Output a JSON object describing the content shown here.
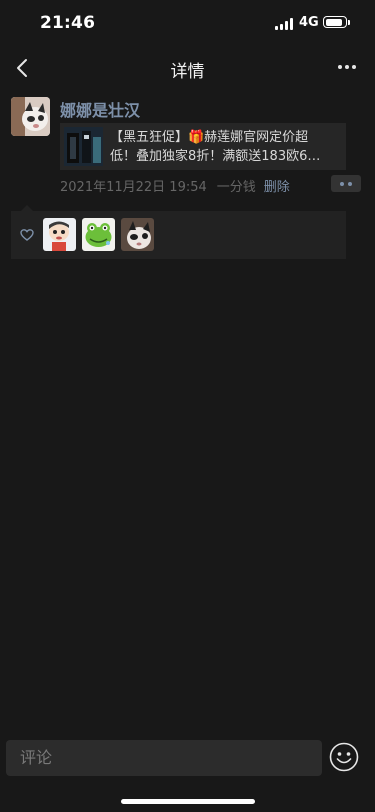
{
  "status_bar": {
    "time": "21:46",
    "network": "4G",
    "battery_level": 0.8
  },
  "nav": {
    "title": "详情",
    "back_icon": "chevron-left-icon",
    "more_icon": "ellipsis-icon"
  },
  "post": {
    "author": "娜娜是壮汉",
    "link_line1": "【黑五狂促】🎁赫莲娜官网定价超",
    "link_line2": "低！叠加独家8折！满额送183欧6…",
    "timestamp": "2021年11月22日 19:54",
    "source": "一分钱",
    "delete_label": "删除"
  },
  "likes": {
    "icon": "heart-icon",
    "users": [
      "liker-cartoon-boy",
      "liker-frog",
      "liker-cat"
    ]
  },
  "composer": {
    "placeholder": "评论",
    "emoji_icon": "smiley-icon"
  },
  "colors": {
    "background": "#181818",
    "accent": "#7d90a9",
    "panel": "#222222"
  }
}
